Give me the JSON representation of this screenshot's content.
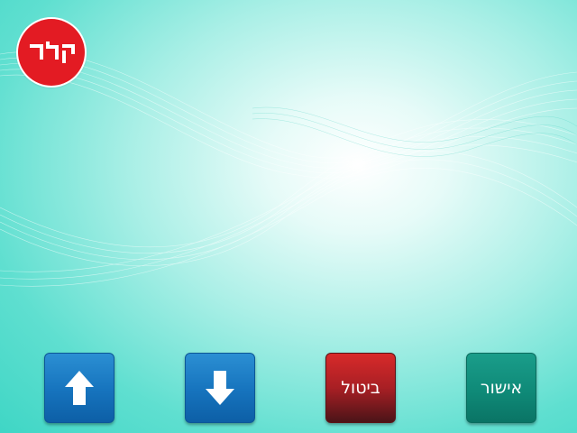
{
  "brand": {
    "logo_text": "דלק",
    "logo_color": "#e31b23"
  },
  "controls": {
    "up": {
      "icon": "arrow-up-icon"
    },
    "down": {
      "icon": "arrow-down-icon"
    },
    "cancel_label": "ביטול",
    "ok_label": "אישור"
  },
  "colors": {
    "background": "#5fdfd0",
    "nav_button": "#1673bd",
    "cancel_button": "#a81f24",
    "ok_button": "#0f8a78"
  }
}
